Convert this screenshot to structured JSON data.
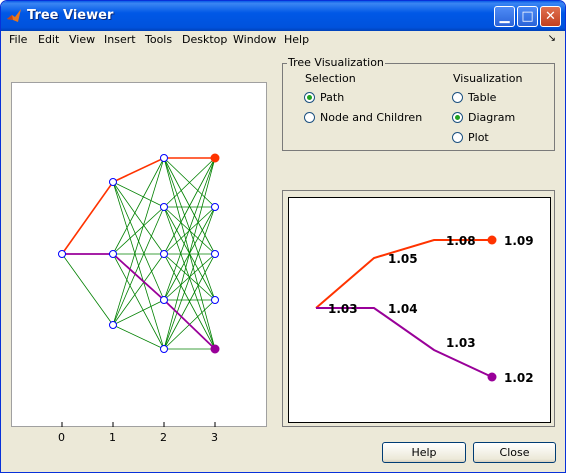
{
  "window": {
    "title": "Tree Viewer"
  },
  "menu": [
    "File",
    "Edit",
    "View",
    "Insert",
    "Tools",
    "Desktop",
    "Window",
    "Help"
  ],
  "tree_axes": {
    "xticks": [
      "0",
      "1",
      "2",
      "3"
    ]
  },
  "group": {
    "title": "Tree Visualization",
    "selection_header": "Selection",
    "selection_options": [
      "Path",
      "Node and Children"
    ],
    "selection_checked": "Path",
    "visualization_header": "Visualization",
    "visualization_options": [
      "Table",
      "Diagram",
      "Plot"
    ],
    "visualization_checked": "Diagram"
  },
  "colors": {
    "path_red": "#ff3300",
    "path_purple": "#990099",
    "tree_green": "#008000",
    "node_blue": "#0000ff"
  },
  "chart_data": {
    "type": "line",
    "series": [
      {
        "points": [
          [
            0,
            1.03
          ],
          [
            1,
            1.05
          ],
          [
            2,
            1.08
          ],
          [
            3,
            1.09
          ]
        ],
        "labels": [
          "1.03",
          "1.05",
          "1.08",
          "1.09"
        ]
      },
      {
        "points": [
          [
            0,
            1.03
          ],
          [
            1,
            1.04
          ],
          [
            2,
            1.03
          ],
          [
            3,
            1.02
          ]
        ],
        "labels": [
          "1.03",
          "1.04",
          "1.03",
          "1.02"
        ]
      }
    ]
  },
  "buttons": {
    "help": "Help",
    "close": "Close"
  }
}
